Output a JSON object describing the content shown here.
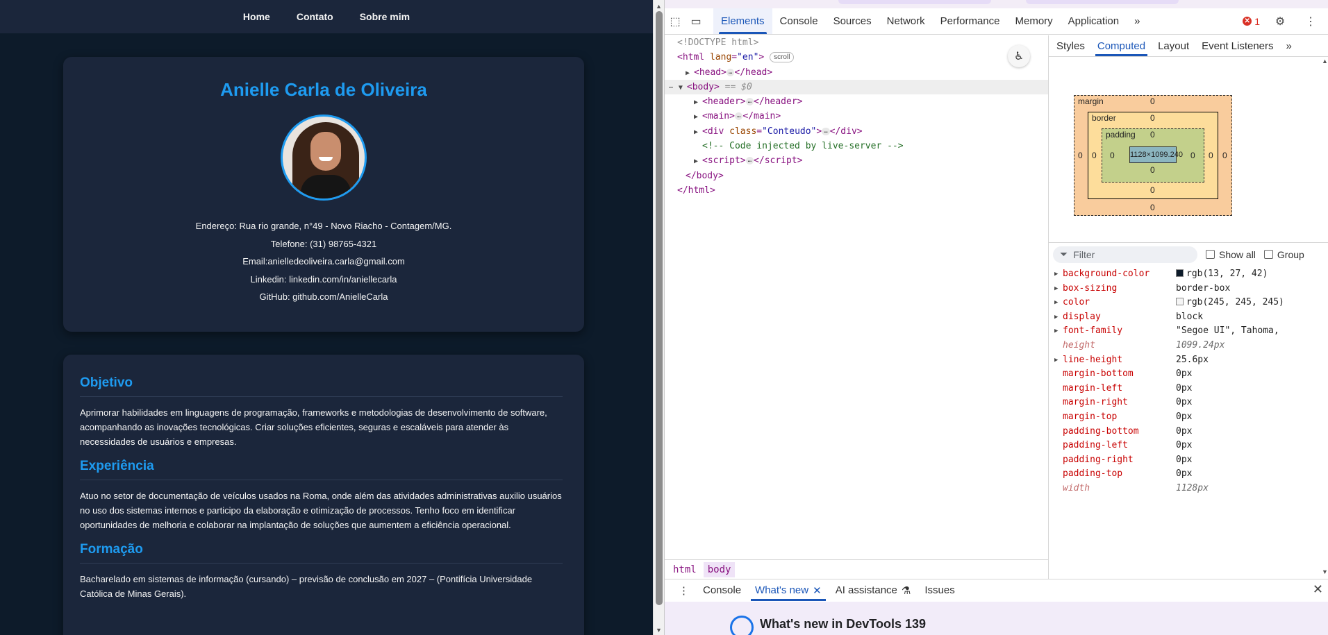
{
  "page": {
    "nav": [
      "Home",
      "Contato",
      "Sobre mim"
    ],
    "name": "Anielle Carla de Oliveira",
    "contact": [
      "Endereço: Rua rio grande, n°49 - Novo Riacho - Contagem/MG.",
      "Telefone: (31) 98765-4321",
      "Email:anielledeoliveira.carla@gmail.com",
      "Linkedin: linkedin.com/in/aniellecarla",
      "GitHub: github.com/AnielleCarla"
    ],
    "sections": [
      {
        "title": "Objetivo",
        "text": "Aprimorar habilidades em linguagens de programação, frameworks e metodologias de desenvolvimento de software, acompanhando as inovações tecnológicas. Criar soluções eficientes, seguras e escaláveis para atender às necessidades de usuários e empresas."
      },
      {
        "title": "Experiência",
        "text": "Atuo no setor de documentação de veículos usados na Roma, onde além das atividades administrativas auxilio usuários no uso dos sistemas internos e participo da elaboração e otimização de processos. Tenho foco em identificar oportunidades de melhoria e colaborar na implantação de soluções que aumentem a eficiência operacional."
      },
      {
        "title": "Formação",
        "text": "Bacharelado em sistemas de informação (cursando) – previsão de conclusão em 2027 – (Pontifícia Universidade Católica de Minas Gerais)."
      }
    ],
    "colors": {
      "background": "#0d1b2a",
      "card": "#1b263b",
      "accent": "#1e9bf0",
      "text": "#f5f5f5"
    }
  },
  "devtools": {
    "tabs": [
      "Elements",
      "Console",
      "Sources",
      "Network",
      "Performance",
      "Memory",
      "Application"
    ],
    "more_tabs": "»",
    "error_count": "1",
    "tree": {
      "doctype": "<!DOCTYPE html>",
      "html_open": "html",
      "lang_attr": "lang",
      "lang_val": "\"en\"",
      "scroll_badge": "scroll",
      "head": "head",
      "body": "body",
      "body_eq": "== $0",
      "header": "header",
      "main": "main",
      "div": "div",
      "class_attr": "class",
      "class_val": "\"Conteudo\"",
      "comment": "<!-- Code injected by live-server -->",
      "script": "script",
      "ellipsis": "…"
    },
    "breadcrumbs": [
      "html",
      "body"
    ],
    "side_tabs": [
      "Styles",
      "Computed",
      "Layout",
      "Event Listeners"
    ],
    "box_model": {
      "margin": "margin",
      "border": "border",
      "padding": "padding",
      "content": "1128×1099.240",
      "zero": "0"
    },
    "filter_placeholder": "Filter",
    "show_all": "Show all",
    "group": "Group",
    "computed": [
      {
        "name": "background-color",
        "value": "rgb(13, 27, 42)",
        "swatch": "#0d1b2a",
        "expandable": true,
        "inherited": false
      },
      {
        "name": "box-sizing",
        "value": "border-box",
        "expandable": true,
        "inherited": false
      },
      {
        "name": "color",
        "value": "rgb(245, 245, 245)",
        "swatch": "#f5f5f5",
        "expandable": true,
        "inherited": false
      },
      {
        "name": "display",
        "value": "block",
        "expandable": true,
        "inherited": false
      },
      {
        "name": "font-family",
        "value": "\"Segoe UI\", Tahoma,",
        "expandable": true,
        "inherited": false
      },
      {
        "name": "height",
        "value": "1099.24px",
        "expandable": false,
        "inherited": true
      },
      {
        "name": "line-height",
        "value": "25.6px",
        "expandable": true,
        "inherited": false
      },
      {
        "name": "margin-bottom",
        "value": "0px",
        "expandable": false,
        "inherited": false
      },
      {
        "name": "margin-left",
        "value": "0px",
        "expandable": false,
        "inherited": false
      },
      {
        "name": "margin-right",
        "value": "0px",
        "expandable": false,
        "inherited": false
      },
      {
        "name": "margin-top",
        "value": "0px",
        "expandable": false,
        "inherited": false
      },
      {
        "name": "padding-bottom",
        "value": "0px",
        "expandable": false,
        "inherited": false
      },
      {
        "name": "padding-left",
        "value": "0px",
        "expandable": false,
        "inherited": false
      },
      {
        "name": "padding-right",
        "value": "0px",
        "expandable": false,
        "inherited": false
      },
      {
        "name": "padding-top",
        "value": "0px",
        "expandable": false,
        "inherited": false
      },
      {
        "name": "width",
        "value": "1128px",
        "expandable": false,
        "inherited": true
      }
    ],
    "drawer_tabs": [
      "Console",
      "What's new",
      "AI assistance",
      "Issues"
    ],
    "whats_new_title": "What's new in DevTools 139"
  }
}
